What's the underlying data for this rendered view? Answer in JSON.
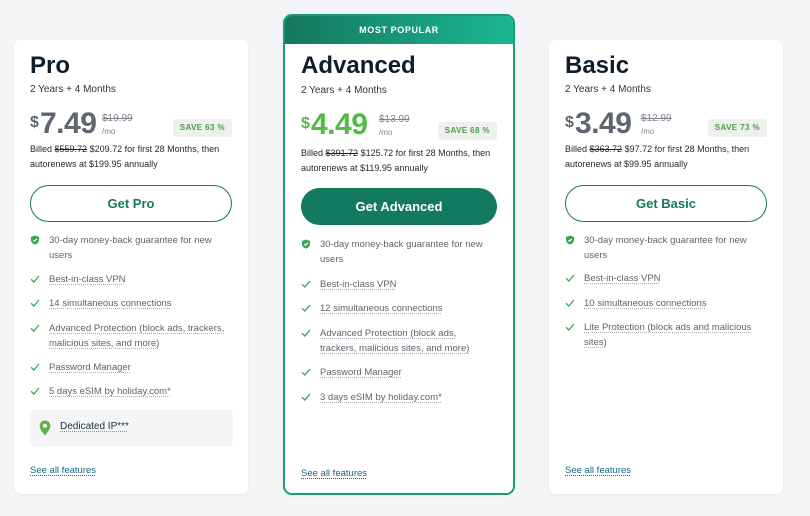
{
  "colors": {
    "accent": "#147a5f",
    "accent_light": "#1ab792",
    "price_green": "#54b947",
    "save_text": "#4d9a4e",
    "check": "#3aa64f",
    "link": "#16658a"
  },
  "plans": {
    "pro": {
      "name": "Pro",
      "term": "2 Years + 4 Months",
      "currency": "$",
      "price": "7.49",
      "original_price": "$19.99",
      "per": "/mo",
      "save": "SAVE 63 %",
      "billed_prefix": "Billed",
      "billed_old": "$559.72",
      "billed_new": "$209.72 for first 28 Months, then",
      "billed_renew": "autorenews at $199.95 annually",
      "button": "Get Pro",
      "features": {
        "guarantee": "30-day money-back guarantee for new users",
        "f1": "Best-in-class VPN",
        "f2": "14 simultaneous connections",
        "f3": "Advanced Protection (block ads, trackers, malicious sites, and more)",
        "f4": "Password Manager",
        "f5": "5 days eSIM by holiday.com*"
      },
      "extra": "Dedicated IP***",
      "see_all": "See all features",
      "shield_icon": "shield-check-icon",
      "check_icon": "check-icon",
      "pin_icon": "location-pin-icon"
    },
    "advanced": {
      "badge": "MOST POPULAR",
      "name": "Advanced",
      "term": "2 Years + 4 Months",
      "currency": "$",
      "price": "4.49",
      "original_price": "$13.99",
      "per": "/mo",
      "save": "SAVE 68 %",
      "billed_prefix": "Billed",
      "billed_old": "$391.72",
      "billed_new": "$125.72 for first 28 Months, then",
      "billed_renew": "autorenews at $119.95 annually",
      "button": "Get Advanced",
      "features": {
        "guarantee": "30-day money-back guarantee for new users",
        "f1": "Best-in-class VPN",
        "f2": "12 simultaneous connections",
        "f3": "Advanced Protection (block ads, trackers, malicious sites, and more)",
        "f4": "Password Manager",
        "f5": "3 days eSIM by holiday.com*"
      },
      "see_all": "See all features"
    },
    "basic": {
      "name": "Basic",
      "term": "2 Years + 4 Months",
      "currency": "$",
      "price": "3.49",
      "original_price": "$12.99",
      "per": "/mo",
      "save": "SAVE 73 %",
      "billed_prefix": "Billed",
      "billed_old": "$363.72",
      "billed_new": "$97.72 for first 28 Months, then",
      "billed_renew": "autorenews at $99.95 annually",
      "button": "Get Basic",
      "features": {
        "guarantee": "30-day money-back guarantee for new users",
        "f1": "Best-in-class VPN",
        "f2": "10 simultaneous connections",
        "f3": "Lite Protection (block ads and malicious sites)"
      },
      "see_all": "See all features"
    }
  }
}
